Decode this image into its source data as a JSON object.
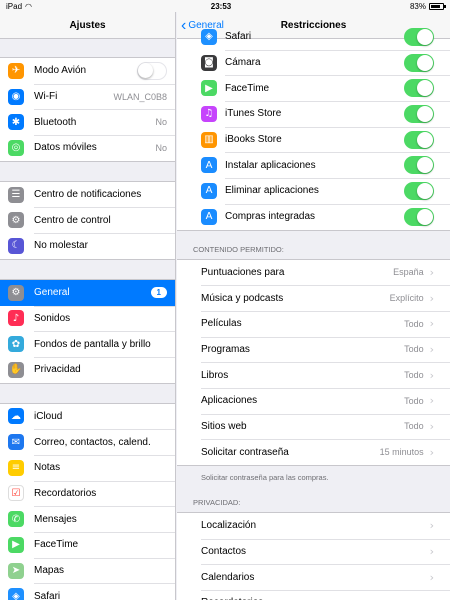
{
  "status": {
    "device": "iPad",
    "time": "23:53",
    "battery": "83%",
    "battery_level": 0.83
  },
  "sidebar": {
    "title": "Ajustes",
    "groups": [
      [
        {
          "label": "Modo Avión",
          "icon": "airplane-icon",
          "color": "#ff9500",
          "glyph": "✈",
          "toggle": "off"
        },
        {
          "label": "Wi-Fi",
          "value": "WLAN_C0B8",
          "icon": "wifi-icon",
          "color": "#007aff",
          "glyph": "◉"
        },
        {
          "label": "Bluetooth",
          "value": "No",
          "icon": "bluetooth-icon",
          "color": "#007aff",
          "glyph": "✱"
        },
        {
          "label": "Datos móviles",
          "value": "No",
          "icon": "cellular-icon",
          "color": "#4cd964",
          "glyph": "◎"
        }
      ],
      [
        {
          "label": "Centro de notificaciones",
          "icon": "notifications-icon",
          "color": "#8e8e93",
          "glyph": "☰"
        },
        {
          "label": "Centro de control",
          "icon": "control-center-icon",
          "color": "#8e8e93",
          "glyph": "⚙"
        },
        {
          "label": "No molestar",
          "icon": "moon-icon",
          "color": "#5856d6",
          "glyph": "☾"
        }
      ],
      [
        {
          "label": "General",
          "icon": "gear-icon",
          "color": "#8e8e93",
          "glyph": "⚙",
          "badge": "1",
          "selected": true
        },
        {
          "label": "Sonidos",
          "icon": "sound-icon",
          "color": "#ff2d55",
          "glyph": "♪"
        },
        {
          "label": "Fondos de pantalla y brillo",
          "icon": "wallpaper-icon",
          "color": "#34aadc",
          "glyph": "✿"
        },
        {
          "label": "Privacidad",
          "icon": "hand-icon",
          "color": "#8e8e93",
          "glyph": "✋"
        }
      ],
      [
        {
          "label": "iCloud",
          "icon": "cloud-icon",
          "color": "#007aff",
          "glyph": "☁"
        },
        {
          "label": "Correo, contactos, calend.",
          "icon": "mail-icon",
          "color": "#1d77ef",
          "glyph": "✉"
        },
        {
          "label": "Notas",
          "icon": "notes-icon",
          "color": "#ffcc00",
          "glyph": "≡"
        },
        {
          "label": "Recordatorios",
          "icon": "reminders-icon",
          "color": "#ffffff",
          "glyph": "☑"
        },
        {
          "label": "Mensajes",
          "icon": "messages-icon",
          "color": "#4cd964",
          "glyph": "✆"
        },
        {
          "label": "FaceTime",
          "icon": "facetime-icon",
          "color": "#4cd964",
          "glyph": "▶"
        },
        {
          "label": "Mapas",
          "icon": "maps-icon",
          "color": "#8fd18f",
          "glyph": "➤"
        },
        {
          "label": "Safari",
          "icon": "safari-icon",
          "color": "#1e90ff",
          "glyph": "◈"
        }
      ]
    ]
  },
  "main": {
    "back_label": "General",
    "title": "Restricciones",
    "apps": [
      {
        "label": "Safari",
        "icon": "safari-icon",
        "color": "#1e90ff",
        "glyph": "◈"
      },
      {
        "label": "Cámara",
        "icon": "camera-icon",
        "color": "#3a3a3c",
        "glyph": "◙"
      },
      {
        "label": "FaceTime",
        "icon": "facetime-icon",
        "color": "#4cd964",
        "glyph": "▶"
      },
      {
        "label": "iTunes Store",
        "icon": "itunes-icon",
        "color": "#c644fc",
        "glyph": "♫"
      },
      {
        "label": "iBooks Store",
        "icon": "ibooks-icon",
        "color": "#ff9500",
        "glyph": "▥"
      },
      {
        "label": "Instalar aplicaciones",
        "icon": "app-store-icon",
        "color": "#1a8cff",
        "glyph": "A"
      },
      {
        "label": "Eliminar aplicaciones",
        "icon": "app-store-icon",
        "color": "#1a8cff",
        "glyph": "A"
      },
      {
        "label": "Compras integradas",
        "icon": "app-store-icon",
        "color": "#1a8cff",
        "glyph": "A"
      }
    ],
    "content_title": "CONTENIDO PERMITIDO:",
    "content": [
      {
        "label": "Puntuaciones para",
        "value": "España"
      },
      {
        "label": "Música y podcasts",
        "value": "Explícito"
      },
      {
        "label": "Películas",
        "value": "Todo"
      },
      {
        "label": "Programas",
        "value": "Todo"
      },
      {
        "label": "Libros",
        "value": "Todo"
      },
      {
        "label": "Aplicaciones",
        "value": "Todo"
      },
      {
        "label": "Sitios web",
        "value": "Todo"
      },
      {
        "label": "Solicitar contraseña",
        "value": "15 minutos"
      }
    ],
    "content_footer": "Solicitar contraseña para las compras.",
    "privacy_title": "PRIVACIDAD:",
    "privacy": [
      {
        "label": "Localización"
      },
      {
        "label": "Contactos"
      },
      {
        "label": "Calendarios"
      },
      {
        "label": "Recordatorios"
      }
    ]
  },
  "colors": {
    "accent": "#007aff",
    "toggle_on": "#4cd964"
  }
}
